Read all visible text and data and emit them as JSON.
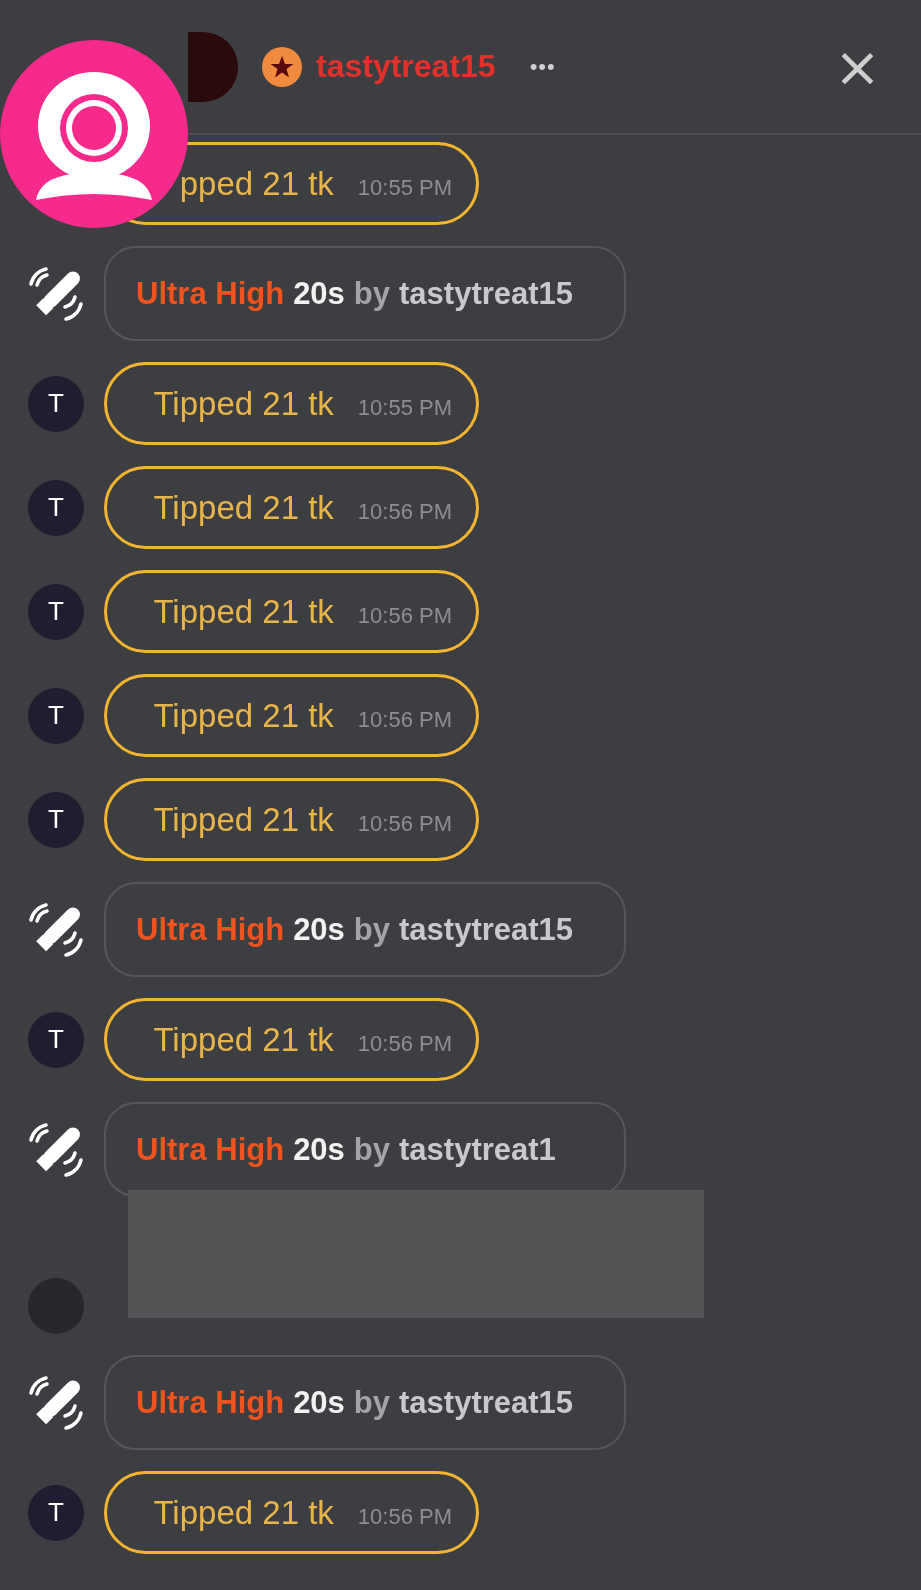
{
  "header": {
    "username": "tastytreat15",
    "more": "•••",
    "close": "×"
  },
  "messages": [
    {
      "kind": "tip",
      "text": "pped 21 tk",
      "time": "10:55 PM"
    },
    {
      "kind": "vibe",
      "level": "Ultra High",
      "duration": "20s",
      "by": "by",
      "user": "tastytreat15"
    },
    {
      "kind": "tip",
      "initial": "T",
      "text": "Tipped 21 tk",
      "time": "10:55 PM"
    },
    {
      "kind": "tip",
      "initial": "T",
      "text": "Tipped 21 tk",
      "time": "10:56 PM"
    },
    {
      "kind": "tip",
      "initial": "T",
      "text": "Tipped 21 tk",
      "time": "10:56 PM"
    },
    {
      "kind": "tip",
      "initial": "T",
      "text": "Tipped 21 tk",
      "time": "10:56 PM"
    },
    {
      "kind": "tip",
      "initial": "T",
      "text": "Tipped 21 tk",
      "time": "10:56 PM"
    },
    {
      "kind": "vibe",
      "level": "Ultra High",
      "duration": "20s",
      "by": "by",
      "user": "tastytreat15"
    },
    {
      "kind": "tip",
      "initial": "T",
      "text": "Tipped 21 tk",
      "time": "10:56 PM"
    },
    {
      "kind": "vibe",
      "level": "Ultra High",
      "duration": "20s",
      "by": "by",
      "user": "tastytreat1"
    },
    {
      "kind": "hidden"
    },
    {
      "kind": "vibe",
      "level": "Ultra High",
      "duration": "20s",
      "by": "by",
      "user": "tastytreat15"
    },
    {
      "kind": "tip",
      "initial": "T",
      "text": "Tipped 21 tk",
      "time": "10:56 PM"
    }
  ]
}
